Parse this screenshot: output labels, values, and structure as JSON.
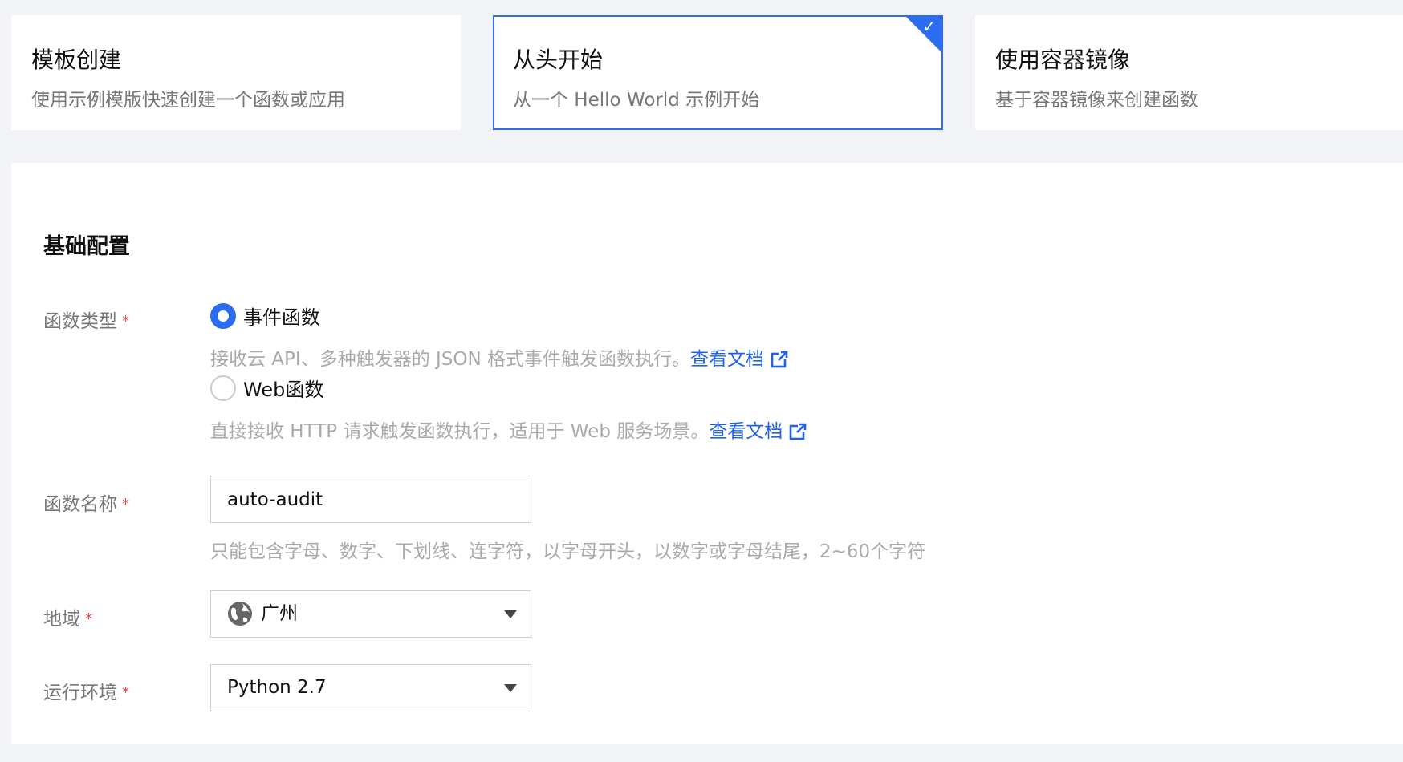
{
  "mode_cards": [
    {
      "title": "模板创建",
      "desc": "使用示例模版快速创建一个函数或应用",
      "selected": false
    },
    {
      "title": "从头开始",
      "desc": "从一个 Hello World 示例开始",
      "selected": true
    },
    {
      "title": "使用容器镜像",
      "desc": "基于容器镜像来创建函数",
      "selected": false
    }
  ],
  "basic_config": {
    "title": "基础配置",
    "function_type": {
      "label": "函数类型",
      "required_mark": "*",
      "options": [
        {
          "label": "事件函数",
          "hint": "接收云 API、多种触发器的 JSON 格式事件触发函数执行。",
          "doc_link": "查看文档",
          "checked": true
        },
        {
          "label": "Web函数",
          "hint": "直接接收 HTTP 请求触发函数执行，适用于 Web 服务场景。",
          "doc_link": "查看文档",
          "checked": false
        }
      ]
    },
    "function_name": {
      "label": "函数名称",
      "required_mark": "*",
      "value": "auto-audit",
      "hint": "只能包含字母、数字、下划线、连字符，以字母开头，以数字或字母结尾，2~60个字符"
    },
    "region": {
      "label": "地域",
      "required_mark": "*",
      "value": "广州",
      "icon": "globe-icon"
    },
    "runtime": {
      "label": "运行环境",
      "required_mark": "*",
      "value": "Python 2.7"
    }
  },
  "colors": {
    "accent": "#2c6cf1",
    "link": "#1f63e8",
    "required": "#e54545",
    "page_bg": "#f2f3f6"
  }
}
